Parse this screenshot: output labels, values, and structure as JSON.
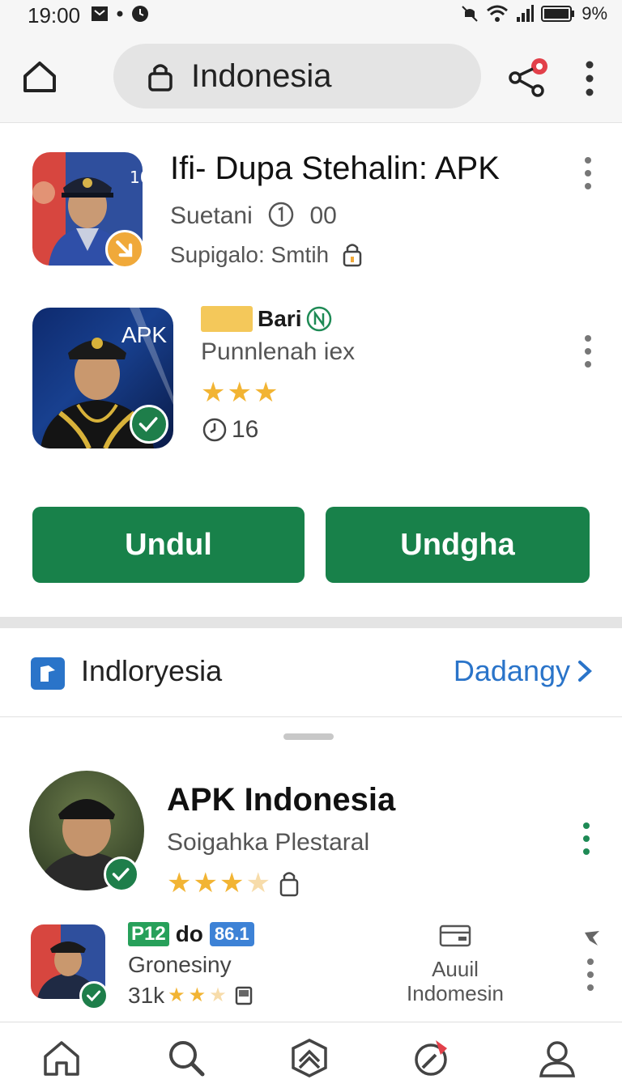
{
  "status_bar": {
    "time": "19:00",
    "battery": "9%"
  },
  "browser": {
    "url_text": "Indonesia"
  },
  "app1": {
    "title": "Ifi- Dupa Stehalin: APK",
    "sub_left": "Suetani",
    "sub_right": "00",
    "sub2": "Supigalo: Smtih"
  },
  "app2": {
    "brand": "Bari",
    "subtitle": "Punnlenah iex",
    "icon_label": "APK",
    "rating": 3,
    "count": "16"
  },
  "buttons": {
    "primary_left": "Undul",
    "primary_right": "Undgha"
  },
  "section": {
    "title": "Indloryesia",
    "link": "Dadangy"
  },
  "featured": {
    "title": "APK Indonesia",
    "subtitle": "Soigahka Plestaral",
    "rating": 3
  },
  "list_row": {
    "tag1": "P12",
    "tag_text": "do",
    "tag2": "86.1",
    "subtitle": "Gronesiny",
    "count": "31k",
    "right_line1": "Auuil",
    "right_line2": "Indomesin"
  },
  "colors": {
    "accent_green": "#18814a",
    "link_blue": "#2a74c9",
    "star": "#f2b433"
  },
  "icons": [
    "home-icon",
    "lock-icon",
    "share-icon",
    "more-vert-icon",
    "search-icon",
    "shield-icon",
    "compass-icon",
    "person-icon"
  ]
}
